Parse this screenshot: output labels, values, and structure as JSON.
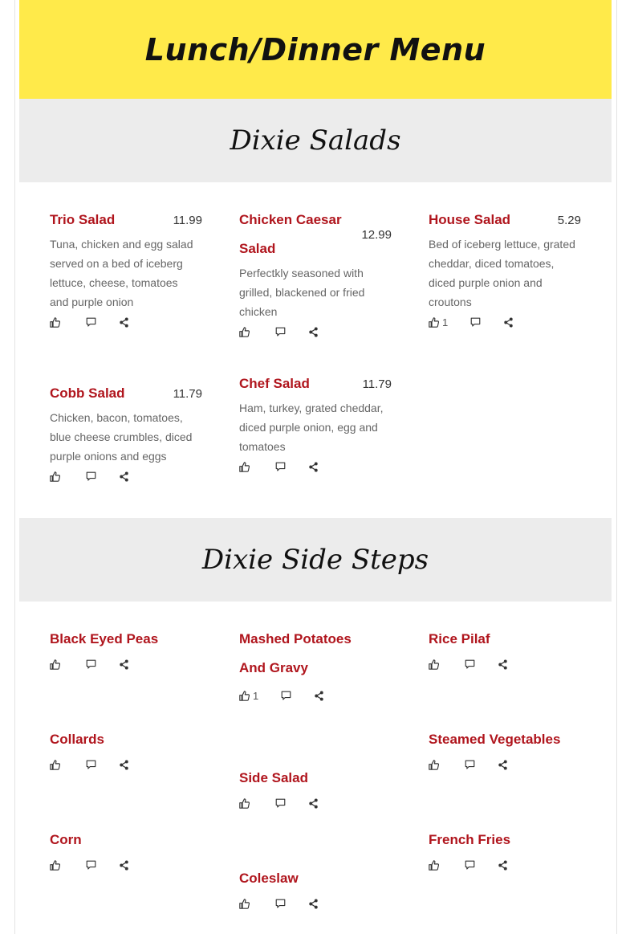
{
  "page": {
    "title": "Lunch/Dinner Menu"
  },
  "sections": [
    {
      "heading": "Dixie Salads",
      "items": [
        {
          "name": "Trio Salad",
          "price": "11.99",
          "desc": "Tuna, chicken and egg salad served on a bed of iceberg lettuce, cheese, tomatoes and purple onion",
          "likes": ""
        },
        {
          "name": "Chicken Caesar Salad",
          "price": "12.99",
          "desc": "Perfectkly seasoned with grilled, blackened or fried chicken",
          "likes": ""
        },
        {
          "name": "House Salad",
          "price": "5.29",
          "desc": "Bed of iceberg lettuce, grated cheddar, diced tomatoes, diced purple onion and croutons",
          "likes": "1"
        },
        {
          "name": "Cobb Salad",
          "price": "11.79",
          "desc": "Chicken, bacon, tomatoes, blue cheese crumbles, diced purple onions and eggs",
          "likes": ""
        },
        {
          "name": "Chef Salad",
          "price": "11.79",
          "desc": "Ham, turkey, grated cheddar, diced purple onion, egg and tomatoes",
          "likes": ""
        }
      ]
    },
    {
      "heading": "Dixie Side Steps",
      "items": [
        {
          "name": "Black Eyed Peas",
          "likes": ""
        },
        {
          "name": "Mashed Potatoes And Gravy",
          "likes": "1"
        },
        {
          "name": "Rice Pilaf",
          "likes": ""
        },
        {
          "name": "Collards",
          "likes": ""
        },
        {
          "name": "Steamed Vegetables",
          "likes": ""
        },
        {
          "name": "Side Salad",
          "likes": ""
        },
        {
          "name": "Corn",
          "likes": ""
        },
        {
          "name": "French Fries",
          "likes": ""
        },
        {
          "name": "Coleslaw",
          "likes": ""
        }
      ]
    }
  ],
  "icons": {
    "like": "thumbs-up-icon",
    "comment": "comment-icon",
    "share": "share-icon"
  },
  "colors": {
    "banner": "#ffea4a",
    "item_title": "#b0151d",
    "section_bg": "#ececec"
  }
}
